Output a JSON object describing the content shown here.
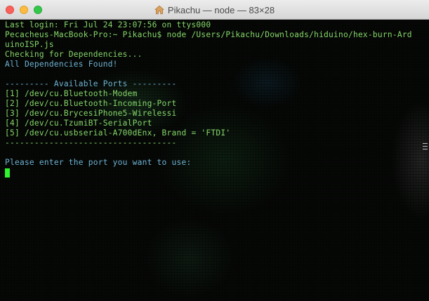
{
  "window": {
    "title": "Pikachu — node — 83×28",
    "title_icon": "home-folder-icon"
  },
  "colors": {
    "terminal_green": "#86d66a",
    "terminal_blue": "#6fb2d2",
    "cursor_green": "#2ef32e"
  },
  "terminal": {
    "lines": [
      {
        "text": "Last login: Fri Jul 24 23:07:56 on ttys000",
        "color": "green"
      },
      {
        "text": "Pecacheus-MacBook-Pro:~ Pikachu$ node /Users/Pikachu/Downloads/hiduino/hex-burn-Ard",
        "color": "green"
      },
      {
        "text": "uinoISP.js",
        "color": "green"
      },
      {
        "text": "Checking for Dependencies...",
        "color": "green"
      },
      {
        "text": "All Dependencies Found!",
        "color": "blue"
      },
      {
        "text": "",
        "color": "green"
      },
      {
        "text": "--------- Available Ports ---------",
        "color": "blue"
      },
      {
        "text": "[1] /dev/cu.Bluetooth-Modem",
        "color": "green"
      },
      {
        "text": "[2] /dev/cu.Bluetooth-Incoming-Port",
        "color": "green"
      },
      {
        "text": "[3] /dev/cu.BrycesiPhone5-Wirelessi",
        "color": "green"
      },
      {
        "text": "[4] /dev/cu.TzumiBT-SerialPort",
        "color": "green"
      },
      {
        "text": "[5] /dev/cu.usbserial-A700dEnx, Brand = 'FTDI'",
        "color": "green"
      },
      {
        "text": "-----------------------------------",
        "color": "green"
      },
      {
        "text": "",
        "color": "green"
      },
      {
        "text": "Please enter the port you want to use:",
        "color": "blue"
      }
    ]
  }
}
